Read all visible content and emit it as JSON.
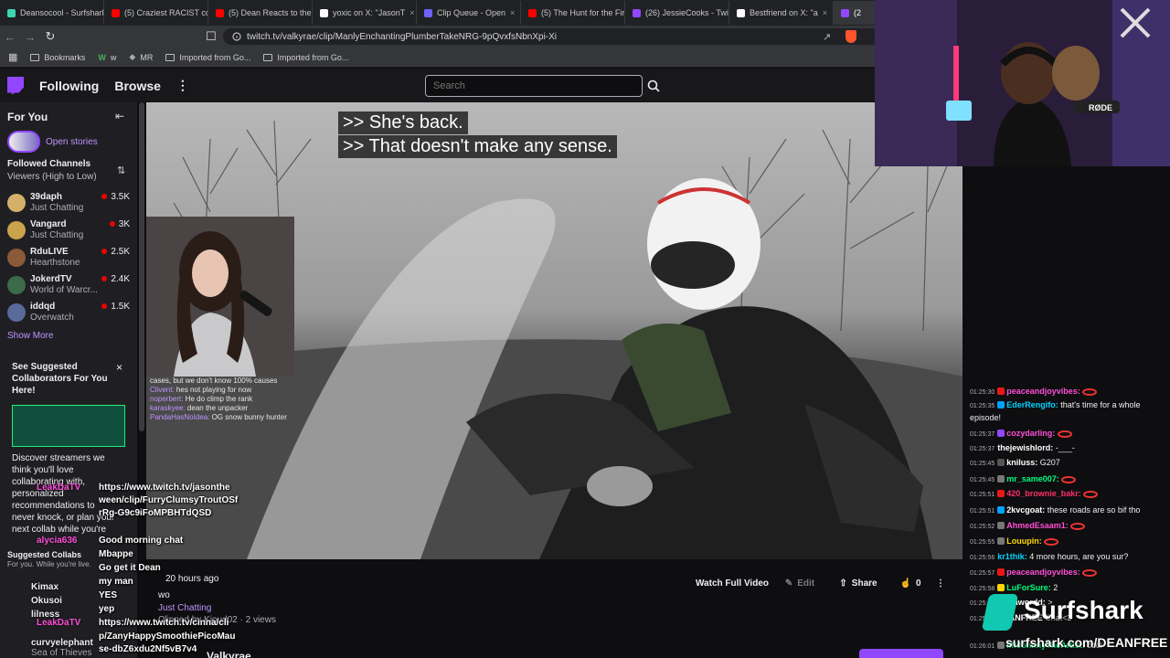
{
  "browser": {
    "tabs": [
      {
        "title": "Deansocool - Surfshark",
        "color": "#3bd6b0"
      },
      {
        "title": "(5) Craziest RACIST co",
        "color": "#ff0000"
      },
      {
        "title": "(5) Dean Reacts to the",
        "color": "#ff0000"
      },
      {
        "title": "yoxic on X: \"JasonT",
        "color": "#ffffff"
      },
      {
        "title": "Clip Queue - Open",
        "color": "#6c63ff"
      },
      {
        "title": "(5) The Hunt for the Fir",
        "color": "#ff0000"
      },
      {
        "title": "(26) JessieCooks - Twit",
        "color": "#9147ff"
      },
      {
        "title": "Bestfriend on X: \"a",
        "color": "#ffffff"
      },
      {
        "title": "(2",
        "color": "#9147ff"
      }
    ],
    "url": "twitch.tv/valkyrae/clip/ManlyEnchantingPlumberTakeNRG-9pQvxfsNbnXpi-Xi",
    "bookmarks": [
      "Bookmarks",
      "w",
      "MR",
      "Imported from Go...",
      "Imported from Go..."
    ]
  },
  "twitch_nav": {
    "following": "Following",
    "browse": "Browse",
    "more": "⋮",
    "search_placeholder": "Search"
  },
  "sidebar": {
    "for_you": "For You",
    "open_stories": "Open stories",
    "followed_title": "Followed Channels",
    "followed_sort": "Viewers (High to Low)",
    "channels": [
      {
        "name": "39daph",
        "game": "Just Chatting",
        "viewers": "3.5K",
        "color": "#d4b06a"
      },
      {
        "name": "Vangard",
        "game": "Just Chatting",
        "viewers": "3K",
        "color": "#c9a44a"
      },
      {
        "name": "RduLIVE",
        "game": "Hearthstone",
        "viewers": "2.5K",
        "color": "#8a5a3a"
      },
      {
        "name": "JokerdTV",
        "game": "World of Warcr...",
        "viewers": "2.4K",
        "color": "#3b6b4a"
      },
      {
        "name": "iddqd",
        "game": "Overwatch",
        "viewers": "1.5K",
        "color": "#5a6a9a"
      }
    ],
    "show_more": "Show More",
    "suggest": {
      "title": "See Suggested Collaborators For You Here!",
      "body": "Discover streamers we think you'll love collaborating with, personalized recommendations to never knock, or plan your next collab while you're",
      "footer_title": "Suggested Collabs",
      "footer_sub": "For you. While you're live."
    }
  },
  "video": {
    "caption_1": ">> She's back.",
    "caption_2": ">> That doesn't make any sense.",
    "inset_chat": [
      {
        "user": "",
        "text": "cases, but we don't know 100% causes"
      },
      {
        "user": "Clivent:",
        "text": "hes not playing for now"
      },
      {
        "user": "noperbert:",
        "text": "He do climp the rank"
      },
      {
        "user": "karaskyee:",
        "text": "dean the unpacker"
      },
      {
        "user": "PandaHasNoIdea:",
        "text": "OG snow bunny hunter"
      }
    ]
  },
  "clip_info": {
    "time_ago": "20 hours ago",
    "title": "wo",
    "category": "Just Chatting",
    "clipped_by": "Clipped by Kioud02 · 2 views",
    "channel": "Valkyrae",
    "watch_full": "Watch Full Video",
    "edit": "Edit",
    "share": "Share",
    "likes": "0",
    "more": "⋮"
  },
  "overlay_chat": [
    {
      "user": "LeakDaTV",
      "text": "https://www.twitch.tv/jasonthe",
      "ucolor": "#ff4fd8"
    },
    {
      "user": "",
      "text": "ween/clip/FurryClumsyTroutOSf",
      "ucolor": "#ffffff"
    },
    {
      "user": "",
      "text": "rRg-G9c9iFoMPBHTdQSD",
      "ucolor": "#ffffff"
    },
    {
      "user": "alycia636",
      "text": "Good morning chat",
      "ucolor": "#ff4fd8"
    },
    {
      "user": "Mbappe",
      "text": "Mbappe",
      "ucolor": "#ffffff"
    },
    {
      "user": "",
      "text": "Go get it Dean",
      "ucolor": "#ffffff"
    },
    {
      "user": "",
      "text": "my man",
      "ucolor": "#ffffff"
    },
    {
      "user": "",
      "text": "YES",
      "ucolor": "#ffffff"
    },
    {
      "user": "",
      "text": "yep",
      "ucolor": "#ffffff"
    },
    {
      "user": "LeakDaTV",
      "text": "https://www.twitch.tv/cinna/cli",
      "ucolor": "#ff4fd8"
    },
    {
      "user": "",
      "text": "p/ZanyHappySmoothiePicoMau",
      "ucolor": "#ffffff"
    },
    {
      "user": "",
      "text": "se-dbZ6xdu2Nf5vB7v4",
      "ucolor": "#ffffff"
    }
  ],
  "overlay_names_left": [
    "Kimax",
    "Okusoi",
    "lilness",
    "curvyelephant"
  ],
  "overlay_games_left": [
    "Sea of Thieves"
  ],
  "chat": [
    {
      "time": "01:25:30",
      "user": "peaceandjoyvibes:",
      "text": "",
      "ucolor": "#ff4fd8",
      "badge": "#e91916"
    },
    {
      "time": "01:25:35",
      "user": "EderRengifo:",
      "text": "that's time for a whole episode!",
      "ucolor": "#00d4ff",
      "badge": "#00a3ff"
    },
    {
      "time": "01:25:37",
      "user": "cozydarling:",
      "text": "",
      "ucolor": "#ff4fd8",
      "badge": "#9147ff"
    },
    {
      "time": "01:25:37",
      "user": "thejewishlord:",
      "text": "-___-",
      "ucolor": "#ffffff",
      "badge": ""
    },
    {
      "time": "01:25:45",
      "user": "kniluss:",
      "text": "G207",
      "ucolor": "#ffffff",
      "badge": "#555"
    },
    {
      "time": "01:25:45",
      "user": "mr_same007:",
      "text": "",
      "ucolor": "#00ff7f",
      "badge": "#777"
    },
    {
      "time": "01:25:51",
      "user": "420_brownie_bakr:",
      "text": "",
      "ucolor": "#ff2f6a",
      "badge": "#e91916"
    },
    {
      "time": "01:25:51",
      "user": "2kvcgoat:",
      "text": "these roads are so bif tho",
      "ucolor": "#ffffff",
      "badge": "#00a3ff"
    },
    {
      "time": "01:25:52",
      "user": "AhmedEsaam1:",
      "text": "",
      "ucolor": "#ff4fd8",
      "badge": "#777"
    },
    {
      "time": "01:25:55",
      "user": "Louupin:",
      "text": "",
      "ucolor": "#ffd700",
      "badge": "#777"
    },
    {
      "time": "01:25:56",
      "user": "kr1thik:",
      "text": "4 more hours, are you sur?",
      "ucolor": "#00d4ff",
      "badge": ""
    },
    {
      "time": "01:25:57",
      "user": "peaceandjoyvibes:",
      "text": "",
      "ucolor": "#ff4fd8",
      "badge": "#e91916"
    },
    {
      "time": "01:25:58",
      "user": "LuForSure:",
      "text": "2",
      "ucolor": "#00ff7f",
      "badge": "#ffd700"
    },
    {
      "time": "01:25:58",
      "user": "Ohwordd:",
      "text": ">",
      "ucolor": "#ffffff",
      "badge": "#777"
    },
    {
      "time": "01:25:59",
      "user": "DEANFREE",
      "text": "Chat<3",
      "ucolor": "#ffffff",
      "badge": ""
    },
    {
      "time": "01:26:01",
      "user": "MrJohnnyTheArtist:",
      "text": "cool",
      "ucolor": "#00ff7f",
      "badge": "#777"
    }
  ],
  "sponsor": {
    "brand": "Surfshark",
    "url": "surfshark.com/DEANFREE"
  },
  "colors": {
    "twitch_purple": "#9147ff",
    "live_red": "#eb0400",
    "surfshark_teal": "#10c9b0"
  }
}
